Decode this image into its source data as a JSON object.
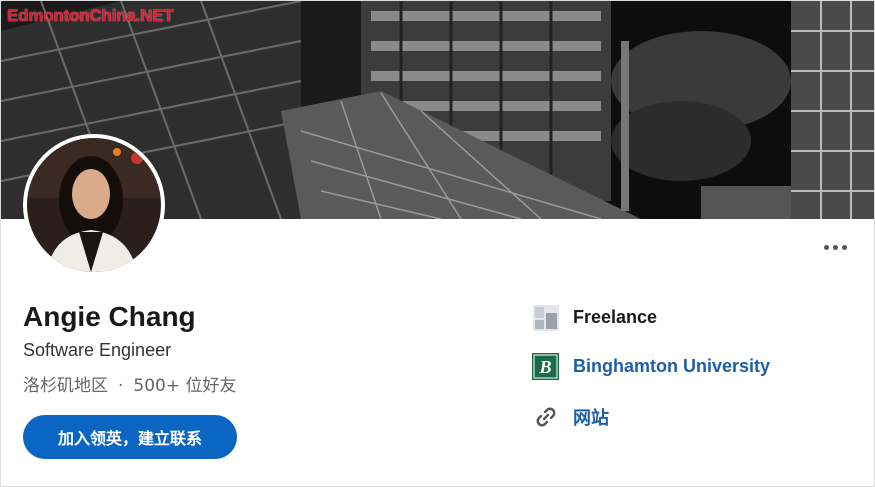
{
  "watermark": "EdmontonChina.NET",
  "profile": {
    "name": "Angie Chang",
    "headline": "Software Engineer",
    "location": "洛杉矶地区",
    "separator": "·",
    "connections": "500+ 位好友",
    "connect_button": "加入领英，建立联系"
  },
  "sidebar": {
    "company": "Freelance",
    "school": "Binghamton University",
    "school_logo_letter": "B",
    "website": "网站"
  },
  "colors": {
    "primary": "#0a66c2",
    "link": "#1d5fa7",
    "school_green": "#1b6b4a"
  },
  "icons": {
    "more": "more-icon",
    "company": "company-logo-icon",
    "school": "school-logo-icon",
    "website": "link-icon"
  }
}
